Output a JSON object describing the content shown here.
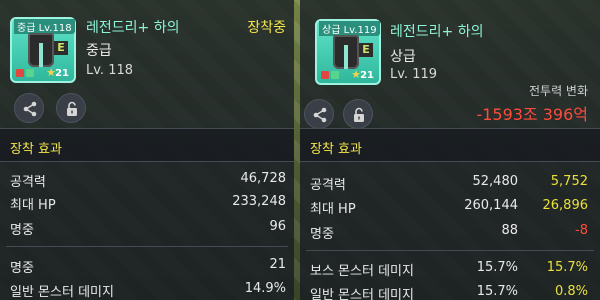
{
  "left_panel": {
    "grade_tag": "중급 Lv.118",
    "item_name": "레전드리+ 하의",
    "grade": "중급",
    "level": "Lv. 118",
    "status": "장착중",
    "star_count": "21",
    "badge_letter": "E",
    "section_title": "장착 효과",
    "stats": [
      {
        "label": "공격력",
        "value": "46,728"
      },
      {
        "label": "최대 HP",
        "value": "233,248"
      },
      {
        "label": "명중",
        "value": "96"
      }
    ],
    "stats2": [
      {
        "label": "명중",
        "value": "21"
      },
      {
        "label": "일반 몬스터 데미지",
        "value": "14.9%"
      }
    ]
  },
  "right_panel": {
    "grade_tag": "상급 Lv.119",
    "item_name": "레전드리+ 하의",
    "grade": "상급",
    "level": "Lv. 119",
    "star_count": "21",
    "badge_letter": "E",
    "power_label": "전투력 변화",
    "power_value": "-1593조 396억",
    "section_title": "장착 효과",
    "stats": [
      {
        "label": "공격력",
        "value": "52,480",
        "diff": "5,752",
        "dir": "up"
      },
      {
        "label": "최대 HP",
        "value": "260,144",
        "diff": "26,896",
        "dir": "up"
      },
      {
        "label": "명중",
        "value": "88",
        "diff": "-8",
        "dir": "down"
      }
    ],
    "stats2": [
      {
        "label": "보스 몬스터 데미지",
        "value": "15.7%",
        "diff": "15.7%",
        "dir": "up"
      },
      {
        "label": "일반 몬스터 데미지",
        "value": "15.7%",
        "diff": "0.8%",
        "dir": "up"
      }
    ]
  },
  "icons": {
    "share": "share-icon",
    "lock": "lock-icon",
    "star": "star-icon"
  },
  "colors": {
    "item_name": "#8cf3d7",
    "equipped": "#f3e54a",
    "increase": "#e9e03a",
    "decrease": "#ff4b3a"
  }
}
